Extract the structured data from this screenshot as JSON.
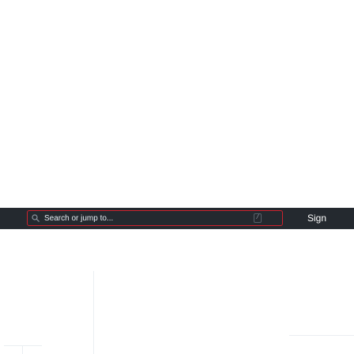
{
  "header": {
    "search": {
      "placeholder": "Search or jump to...",
      "shortcut_key": "/"
    },
    "signin_label": "Sign"
  },
  "colors": {
    "header_bg": "#24292f",
    "search_border": "#cf222e",
    "header_text": "#ffffff"
  },
  "icons": {
    "search": "search-icon"
  }
}
